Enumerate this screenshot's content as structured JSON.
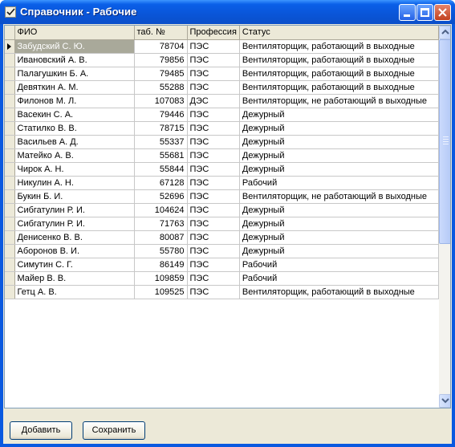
{
  "window": {
    "title": "Справочник - Рабочие"
  },
  "grid": {
    "columns": [
      "ФИО",
      "таб. №",
      "Профессия",
      "Статус"
    ],
    "selected_row": 0,
    "rows": [
      {
        "fio": "Забудский С. Ю.",
        "tab": "78704",
        "prof": "ПЭС",
        "status": "Вентиляторщик, работающий в выходные"
      },
      {
        "fio": "Ивановский А. В.",
        "tab": "79856",
        "prof": "ПЭС",
        "status": "Вентиляторщик, работающий в выходные"
      },
      {
        "fio": "Палагушкин Б. А.",
        "tab": "79485",
        "prof": "ПЭС",
        "status": "Вентиляторщик, работающий в выходные"
      },
      {
        "fio": "Девяткин А. М.",
        "tab": "55288",
        "prof": "ПЭС",
        "status": "Вентиляторщик, работающий в выходные"
      },
      {
        "fio": "Филонов М. Л.",
        "tab": "107083",
        "prof": "ДЭС",
        "status": "Вентиляторщик, не работающий в выходные"
      },
      {
        "fio": "Васекин С. А.",
        "tab": "79446",
        "prof": "ПЭС",
        "status": "Дежурный"
      },
      {
        "fio": "Статилко В. В.",
        "tab": "78715",
        "prof": "ПЭС",
        "status": "Дежурный"
      },
      {
        "fio": "Васильев А. Д.",
        "tab": "55337",
        "prof": "ПЭС",
        "status": "Дежурный"
      },
      {
        "fio": "Матейко А. В.",
        "tab": "55681",
        "prof": "ПЭС",
        "status": "Дежурный"
      },
      {
        "fio": "Чирок А. Н.",
        "tab": "55844",
        "prof": "ПЭС",
        "status": "Дежурный"
      },
      {
        "fio": "Никулин А. Н.",
        "tab": "67128",
        "prof": "ПЭС",
        "status": "Рабочий"
      },
      {
        "fio": "Букин Б. И.",
        "tab": "52696",
        "prof": "ПЭС",
        "status": "Вентиляторщик, не работающий в выходные"
      },
      {
        "fio": "Сибгатулин Р. И.",
        "tab": "104624",
        "prof": "ПЭС",
        "status": "Дежурный"
      },
      {
        "fio": "Сибгатулин Р. И.",
        "tab": "71763",
        "prof": "ПЭС",
        "status": "Дежурный"
      },
      {
        "fio": "Денисенко В. В.",
        "tab": "80087",
        "prof": "ПЭС",
        "status": "Дежурный"
      },
      {
        "fio": "Аборонов В. И.",
        "tab": "55780",
        "prof": "ПЭС",
        "status": "Дежурный"
      },
      {
        "fio": "Симутин С. Г.",
        "tab": "86149",
        "prof": "ПЭС",
        "status": "Рабочий"
      },
      {
        "fio": "Майер В. В.",
        "tab": "109859",
        "prof": "ПЭС",
        "status": "Рабочий"
      },
      {
        "fio": "Гетц А. В.",
        "tab": "109525",
        "prof": "ПЭС",
        "status": "Вентиляторщик, работающий в выходные"
      }
    ]
  },
  "buttons": {
    "add": "Добавить",
    "save": "Сохранить"
  },
  "icons": {
    "app": "checkmark-document-icon",
    "minimize": "minimize-icon",
    "maximize": "maximize-icon",
    "close": "close-icon",
    "row_indicator": "current-row-arrow-icon",
    "scroll_up": "scroll-up-icon",
    "scroll_down": "scroll-down-icon"
  },
  "colors": {
    "titlebar": "#0a55d8",
    "client_bg": "#ece9d8",
    "selected_cell": "#a9a99a",
    "close_button": "#c2411e"
  }
}
